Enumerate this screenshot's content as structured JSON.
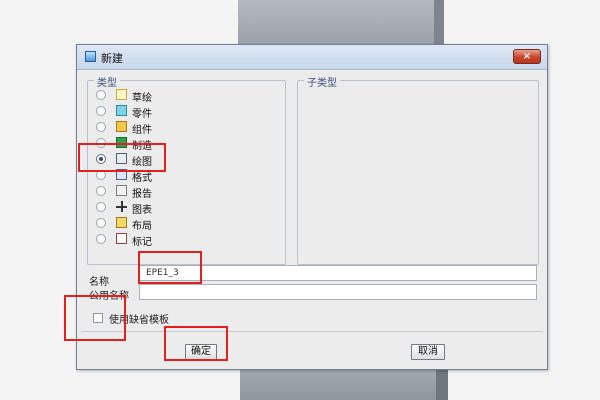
{
  "dialog": {
    "title": "新建",
    "close_label": "×"
  },
  "type_group": {
    "legend": "类型",
    "items": [
      {
        "label": "草绘",
        "selected": false,
        "icon": "sketch-icon"
      },
      {
        "label": "零件",
        "selected": false,
        "icon": "part-icon"
      },
      {
        "label": "组件",
        "selected": false,
        "icon": "assembly-icon"
      },
      {
        "label": "制造",
        "selected": false,
        "icon": "manufacturing-icon"
      },
      {
        "label": "绘图",
        "selected": true,
        "icon": "drawing-icon"
      },
      {
        "label": "格式",
        "selected": false,
        "icon": "format-icon"
      },
      {
        "label": "报告",
        "selected": false,
        "icon": "report-icon"
      },
      {
        "label": "图表",
        "selected": false,
        "icon": "diagram-icon"
      },
      {
        "label": "布局",
        "selected": false,
        "icon": "layout-icon"
      },
      {
        "label": "标记",
        "selected": false,
        "icon": "markup-icon"
      }
    ]
  },
  "subtype_group": {
    "legend": "子类型"
  },
  "name": {
    "label": "名称",
    "value": "EPE1_3"
  },
  "common_name": {
    "label": "公用名称",
    "value": ""
  },
  "default_template": {
    "label": "使用缺省模板",
    "checked": false
  },
  "buttons": {
    "ok": "确定",
    "cancel": "取消"
  },
  "colors": {
    "annotation": "#e3201d",
    "title_bar": "#c7d6ea",
    "close_button": "#c9452c"
  }
}
